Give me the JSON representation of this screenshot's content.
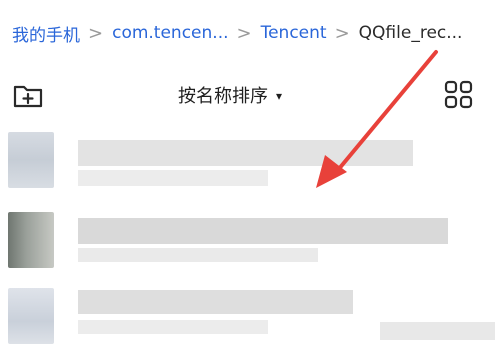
{
  "breadcrumb": {
    "items": [
      "我的手机",
      "com.tencen...",
      "Tencent",
      "QQfile_rec..."
    ],
    "separator": ">"
  },
  "toolbar": {
    "new_folder_icon": "folder-add-icon",
    "sort_label": "按名称排序",
    "sort_caret": "▾",
    "view_icon": "grid-view-icon"
  },
  "file_list": {
    "rows": [
      {
        "name_visible": false,
        "state": "pixelated"
      },
      {
        "name_visible": false,
        "state": "pixelated"
      },
      {
        "name_visible": false,
        "state": "pixelated"
      }
    ]
  },
  "annotation": {
    "type": "arrow",
    "color": "#e8413a"
  },
  "colors": {
    "link": "#2a66d9",
    "text": "#1f1f1f",
    "background": "#ffffff",
    "mosaic": "#dcdcdc"
  }
}
